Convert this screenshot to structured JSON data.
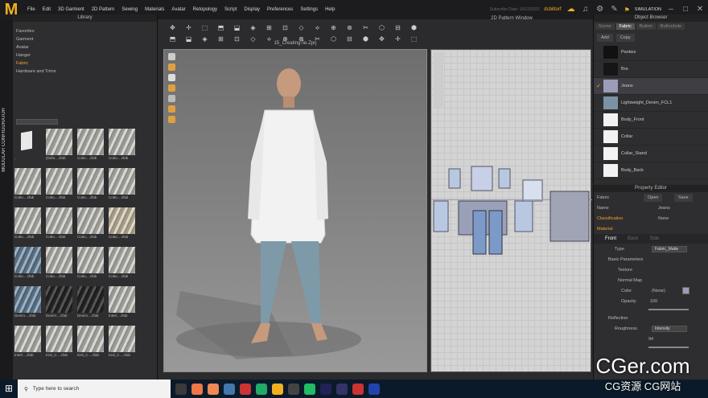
{
  "app": {
    "logo": "M"
  },
  "menu": [
    "File",
    "Edit",
    "3D Garment",
    "2D Pattern",
    "Sewing",
    "Materials",
    "Avatar",
    "Retopology",
    "Script",
    "Display",
    "Preferences",
    "Settings",
    "Help"
  ],
  "topbar": {
    "user": "dcbittorf",
    "license_text": "Subscribe Date: 10/11/2023",
    "simulation": "SIMULATION"
  },
  "side_tabs": [
    "MODULAR CONFIGURATOR"
  ],
  "library": {
    "title": "Library",
    "items": [
      "Favorites",
      "Garment",
      "Avatar",
      "Hanger",
      "Fabric",
      "Hardware and Trims"
    ],
    "selected": "Fabric",
    "thumbs": [
      {
        "caption": "..",
        "style": "folder"
      },
      {
        "caption": "(Defa....zfab",
        "style": "plain"
      },
      {
        "caption": "Cotto....zfab",
        "style": "plain"
      },
      {
        "caption": "Cotto....zfab",
        "style": "plain"
      },
      {
        "caption": "Cotto....zfab",
        "style": "plain"
      },
      {
        "caption": "Cotto....zfab",
        "style": "plain"
      },
      {
        "caption": "Cotto....zfab",
        "style": "plain"
      },
      {
        "caption": "Cotto....zfab",
        "style": "plain"
      },
      {
        "caption": "Cotto....zfab",
        "style": "plain"
      },
      {
        "caption": "Cotto....zfab",
        "style": "plain"
      },
      {
        "caption": "Cotto....zfab",
        "style": "plain"
      },
      {
        "caption": "Cotto....zfab",
        "style": "cream"
      },
      {
        "caption": "Cotto....zfab",
        "style": "blue"
      },
      {
        "caption": "Cotto....zfab",
        "style": "plain"
      },
      {
        "caption": "Cotto....zfab",
        "style": "plain"
      },
      {
        "caption": "Cotto....zfab",
        "style": "plain"
      },
      {
        "caption": "Denim....zfab",
        "style": "blue"
      },
      {
        "caption": "Denim....zfab",
        "style": "dark"
      },
      {
        "caption": "Denim....zfab",
        "style": "dark"
      },
      {
        "caption": "Interl....zfab",
        "style": "plain"
      },
      {
        "caption": "Interl....zfab",
        "style": "plain"
      },
      {
        "caption": "Knit_C....zfab",
        "style": "plain"
      },
      {
        "caption": "Knit_C....zfab",
        "style": "plain"
      },
      {
        "caption": "Knit_C....zfab",
        "style": "plain"
      }
    ]
  },
  "viewport": {
    "title": "15_CreatingTie.Zprj"
  },
  "pattern_window": {
    "title": "2D Pattern Window"
  },
  "object_browser": {
    "title": "Object Browser",
    "tabs": [
      "Scene",
      "Fabric",
      "Button",
      "Buttonhole"
    ],
    "active_tab": "Fabric",
    "add_label": "Add",
    "copy_label": "Copy",
    "fabrics": [
      {
        "name": "Panties",
        "color": "#111111",
        "selected": false
      },
      {
        "name": "Bra",
        "color": "#161616",
        "selected": false
      },
      {
        "name": "Jeans",
        "color": "#9a9cb8",
        "selected": true
      },
      {
        "name": "Lightweight_Denim_FCL1",
        "color": "#7c92a4",
        "selected": false
      },
      {
        "name": "Body_Front",
        "color": "#f2f2f2",
        "selected": false
      },
      {
        "name": "Collar",
        "color": "#f2f2f2",
        "selected": false
      },
      {
        "name": "Collar_Stand",
        "color": "#f2f2f2",
        "selected": false
      },
      {
        "name": "Body_Back",
        "color": "#f2f2f2",
        "selected": false
      }
    ]
  },
  "property_editor": {
    "title": "Property Editor",
    "section": "Fabric",
    "open_label": "Open",
    "save_label": "Save",
    "name_label": "Name",
    "name_value": "Jeans",
    "classification_label": "Classification",
    "classification_value": "None",
    "material_label": "Material",
    "tabs": [
      "Front",
      "Back",
      "Side"
    ],
    "type_label": "Type",
    "type_value": "Fabric_Matte",
    "basic_params": "Basic Parameters",
    "texture": "Texture",
    "normal_map": "Normal Map",
    "color_label": "Color",
    "color_value": "(None)",
    "color_swatch": "#9a9cb8",
    "opacity_label": "Opacity",
    "opacity_value": "100",
    "reflection_label": "Reflection",
    "roughness_label": "Roughness",
    "roughness_type": "Intensity",
    "roughness_value": "94"
  },
  "taskbar": {
    "search_placeholder": "Type here to search",
    "start_icon": "windows-icon"
  },
  "watermark": {
    "main": "CGer.com",
    "sub": "CG资源 CG网站"
  }
}
